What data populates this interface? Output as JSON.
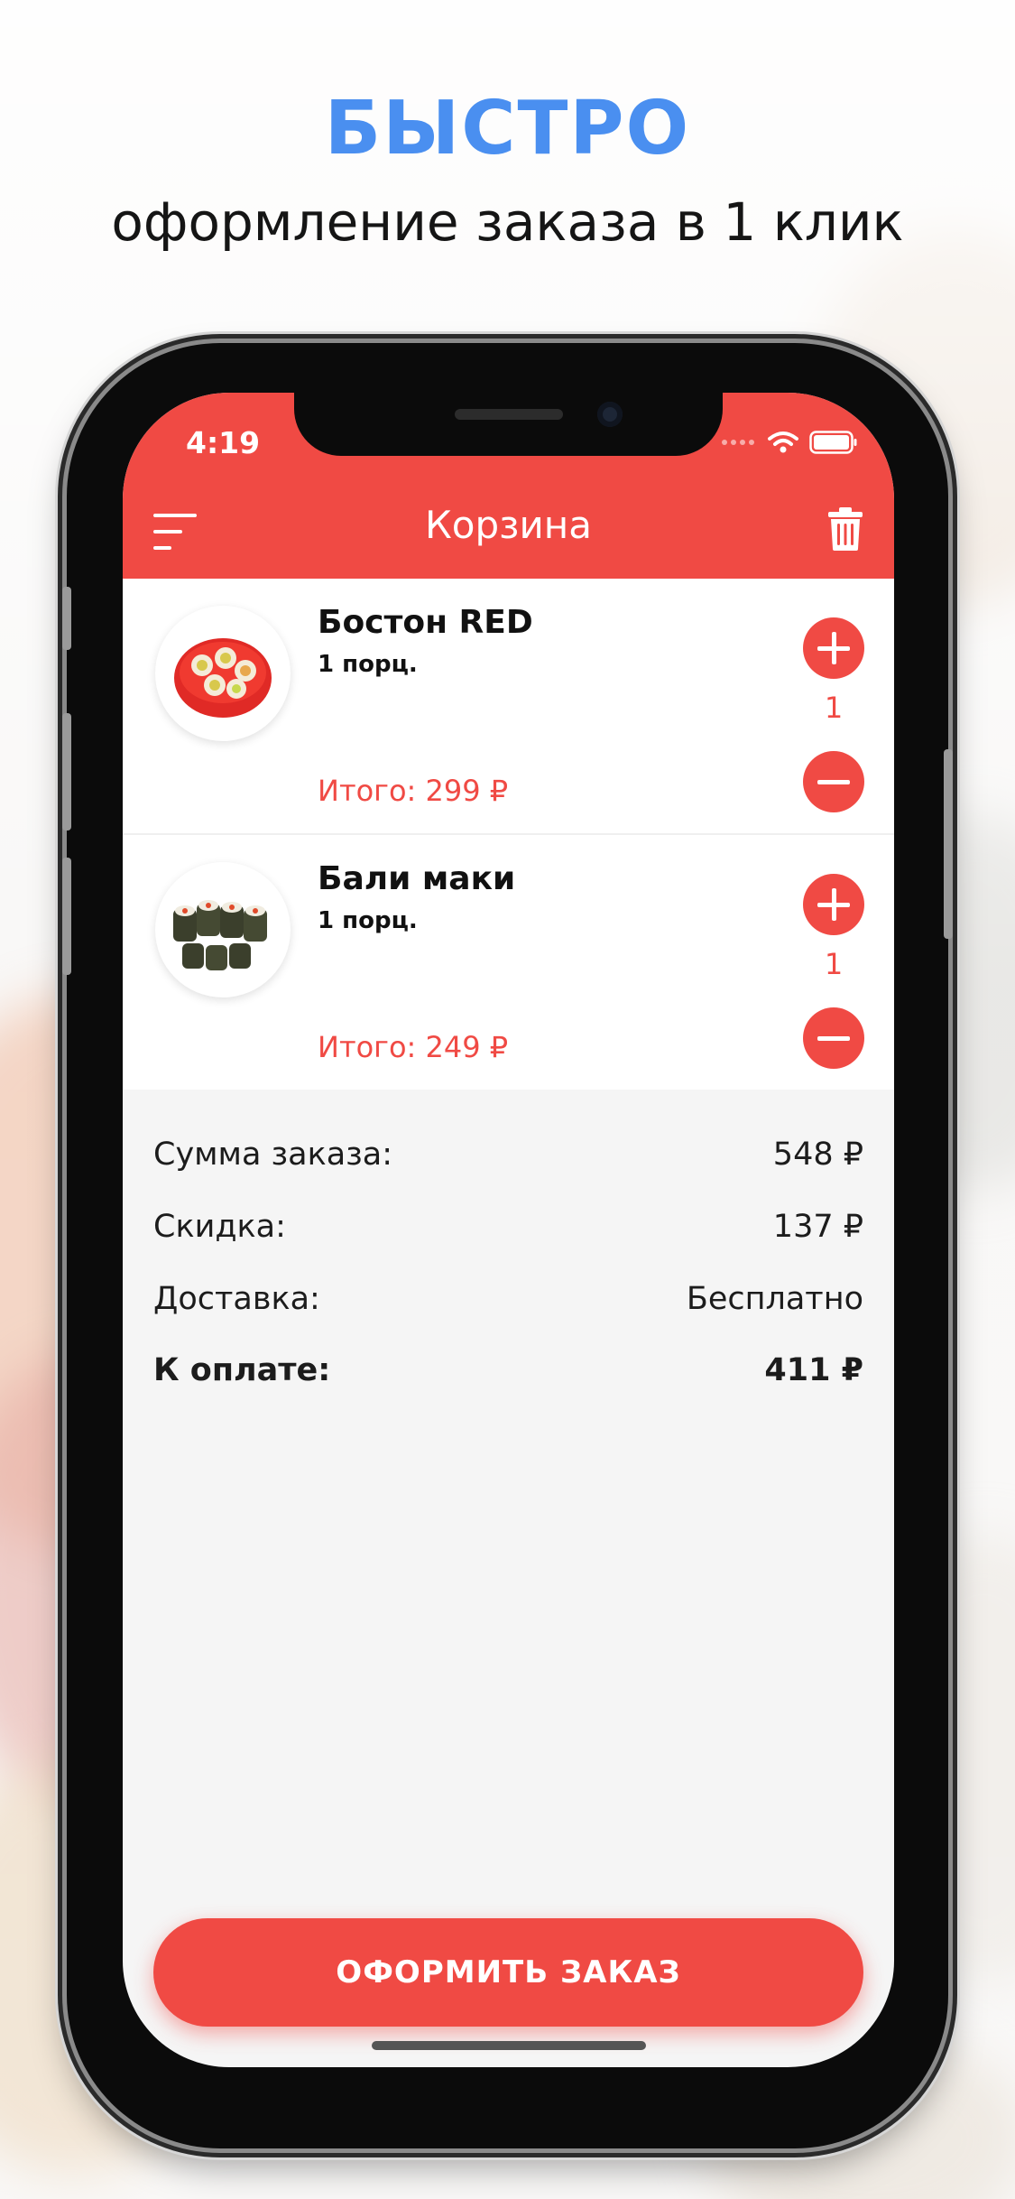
{
  "promo": {
    "headline": "БЫСТРО",
    "subline": "оформление заказа в 1 клик",
    "headline_color": "#4a8ff0"
  },
  "status_bar": {
    "time": "4:19"
  },
  "header": {
    "title": "Корзина",
    "menu_icon": "hamburger-menu-icon",
    "trash_icon": "trash-icon"
  },
  "accent_color": "#f04a44",
  "cart": {
    "items": [
      {
        "name": "Бостон RED",
        "portion": "1 порц.",
        "quantity": "1",
        "total": "Итого: 299 ₽"
      },
      {
        "name": "Бали маки",
        "portion": "1 порц.",
        "quantity": "1",
        "total": "Итого: 249 ₽"
      }
    ]
  },
  "summary": {
    "rows": [
      {
        "label": "Сумма заказа:",
        "value": "548 ₽"
      },
      {
        "label": "Скидка:",
        "value": "137 ₽"
      },
      {
        "label": "Доставка:",
        "value": "Бесплатно"
      },
      {
        "label": "К оплате:",
        "value": "411 ₽"
      }
    ]
  },
  "checkout_button": "ОФОРМИТЬ ЗАКАЗ"
}
